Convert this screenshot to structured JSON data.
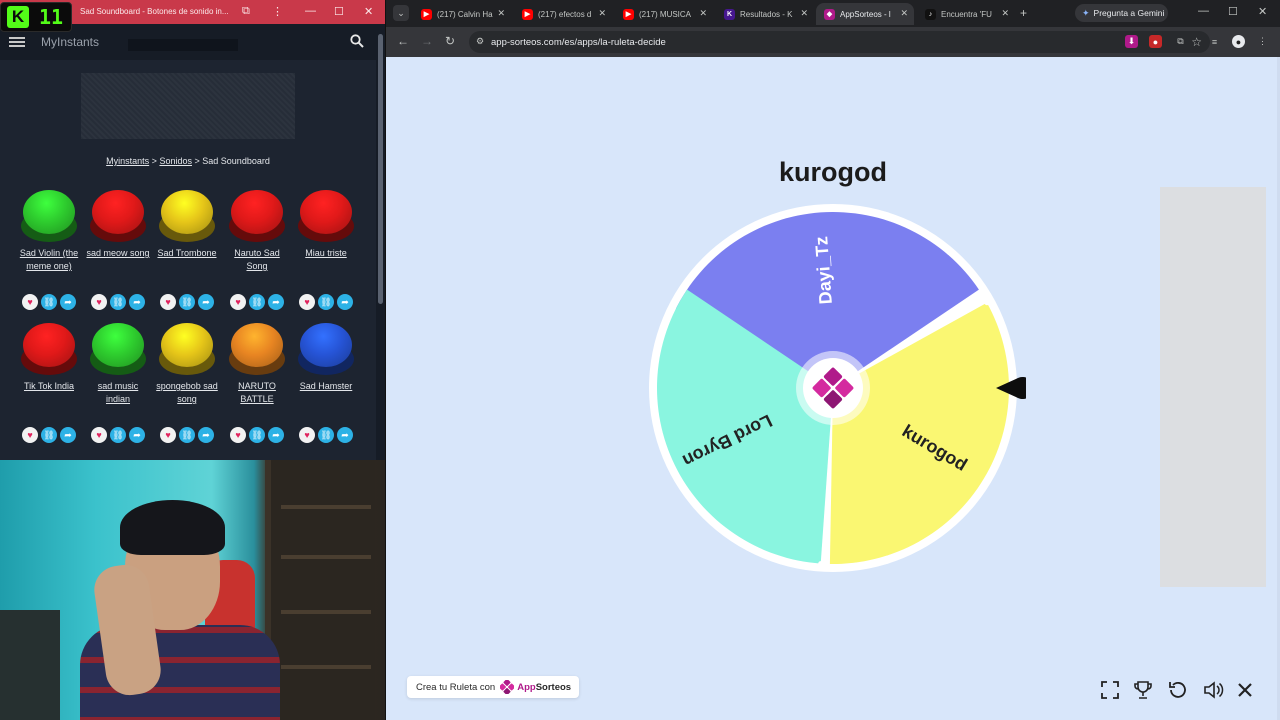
{
  "left_window": {
    "title": "Sad Soundboard - Botones de sonido in...",
    "kick_counter": "11",
    "site_name": "MyInstants",
    "breadcrumb": {
      "home": "Myinstants",
      "sep1": ">",
      "section": "Sonidos",
      "sep2": ">",
      "current": "Sad Soundboard"
    },
    "sounds": [
      {
        "label": "Sad Violin (the meme one)",
        "color": "#2ecc2e"
      },
      {
        "label": "sad meow song",
        "color": "#e01919"
      },
      {
        "label": "Sad Trombone",
        "color": "#e6c619"
      },
      {
        "label": "Naruto Sad Song",
        "color": "#e01919"
      },
      {
        "label": "Miau triste",
        "color": "#e01919"
      },
      {
        "label": "Tik Tok India",
        "color": "#e01919"
      },
      {
        "label": "sad music indian",
        "color": "#2ecc2e"
      },
      {
        "label": "spongebob sad song",
        "color": "#e6c619"
      },
      {
        "label": "NARUTO BATTLE",
        "color": "#e88522"
      },
      {
        "label": "Sad Hamster",
        "color": "#2654d6"
      }
    ]
  },
  "browser": {
    "tabs": [
      {
        "title": "(217) Calvin Ha",
        "icon": "youtube-icon",
        "color": "#ff0000"
      },
      {
        "title": "(217) efectos d",
        "icon": "youtube-icon",
        "color": "#ff0000"
      },
      {
        "title": "(217) MUSICA",
        "icon": "youtube-icon",
        "color": "#ff0000"
      },
      {
        "title": "Resultados - K",
        "icon": "kahoot-icon",
        "color": "#46178f"
      },
      {
        "title": "AppSorteos - l",
        "icon": "appsorteos-icon",
        "color": "#b01a8a",
        "active": true
      },
      {
        "title": "Encuentra 'FU",
        "icon": "tiktok-icon",
        "color": "#111111"
      }
    ],
    "gemini_label": "Pregunta a Gemini",
    "url": "app-sorteos.com/es/apps/la-ruleta-decide"
  },
  "page": {
    "winner": "kurogod",
    "wheel": {
      "segments": [
        {
          "label": "Dayi_Tz",
          "color": "#7b7ff0"
        },
        {
          "label": "kurogod",
          "color": "#faf772"
        },
        {
          "label": "Lord Byron",
          "color": "#8af5e0"
        }
      ],
      "center_color": "#b01a8a"
    },
    "footer": {
      "prefix": "Crea tu Ruleta con",
      "brand_a": "App",
      "brand_b": "Sorteos"
    },
    "controls": [
      "fullscreen-icon",
      "trophy-icon",
      "reset-icon",
      "volume-icon",
      "close-icon"
    ]
  }
}
